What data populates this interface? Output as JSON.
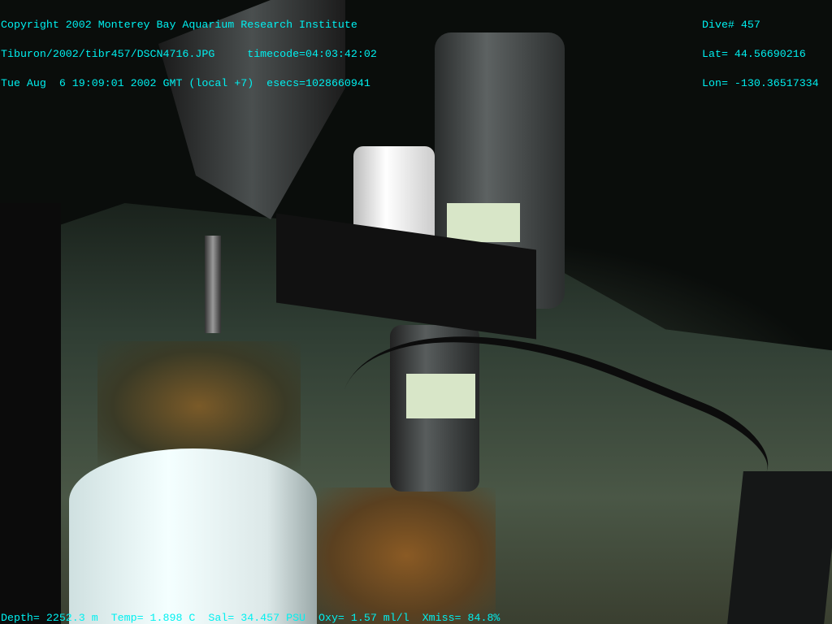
{
  "overlay_top_left": {
    "line1": "Copyright 2002 Monterey Bay Aquarium Research Institute",
    "line2": "Tiburon/2002/tibr457/DSCN4716.JPG     timecode=04:03:42:02",
    "line3": "Tue Aug  6 19:09:01 2002 GMT (local +7)  esecs=1028660941"
  },
  "overlay_top_right": {
    "dive": "Dive# 457",
    "lat": "Lat= 44.56690216",
    "lon": "Lon= -130.36517334"
  },
  "overlay_bottom": {
    "text": "Depth= 2252.3 m  Temp= 1.898 C  Sal= 34.457 PSU  Oxy= 1.57 ml/l  Xmiss= 84.8%"
  },
  "colors": {
    "overlay_text": "#00f0f0",
    "seafloor": "#3d4a3a"
  }
}
